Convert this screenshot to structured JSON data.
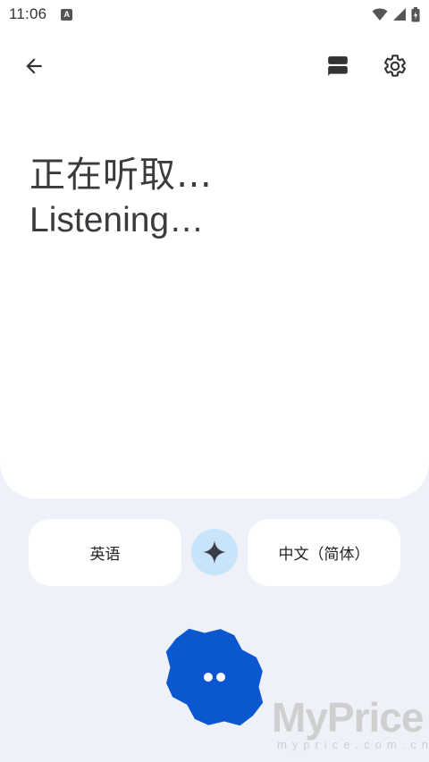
{
  "status_bar": {
    "time": "11:06",
    "notification_badge": "A",
    "icons": [
      "wifi-icon",
      "cell-signal-icon",
      "battery-icon"
    ]
  },
  "app_bar": {
    "back_icon": "arrow-back-icon",
    "layout_icon": "split-view-icon",
    "settings_icon": "gear-icon"
  },
  "transcript": {
    "source_line": "正在听取…",
    "target_line": "Listening…"
  },
  "languages": {
    "source": "英语",
    "target": "中文（简体）",
    "swap_icon": "sparkle-icon"
  },
  "mic": {
    "icon": "listening-dots-icon",
    "color": "#0b57d0"
  },
  "watermark": {
    "brand": "MyPrice",
    "domain": "myprice.com.cn"
  },
  "colors": {
    "background": "#eef1f7",
    "card": "#ffffff",
    "swap_bg": "#c8e4fb",
    "accent": "#0b57d0",
    "text": "#3b3b3f"
  }
}
